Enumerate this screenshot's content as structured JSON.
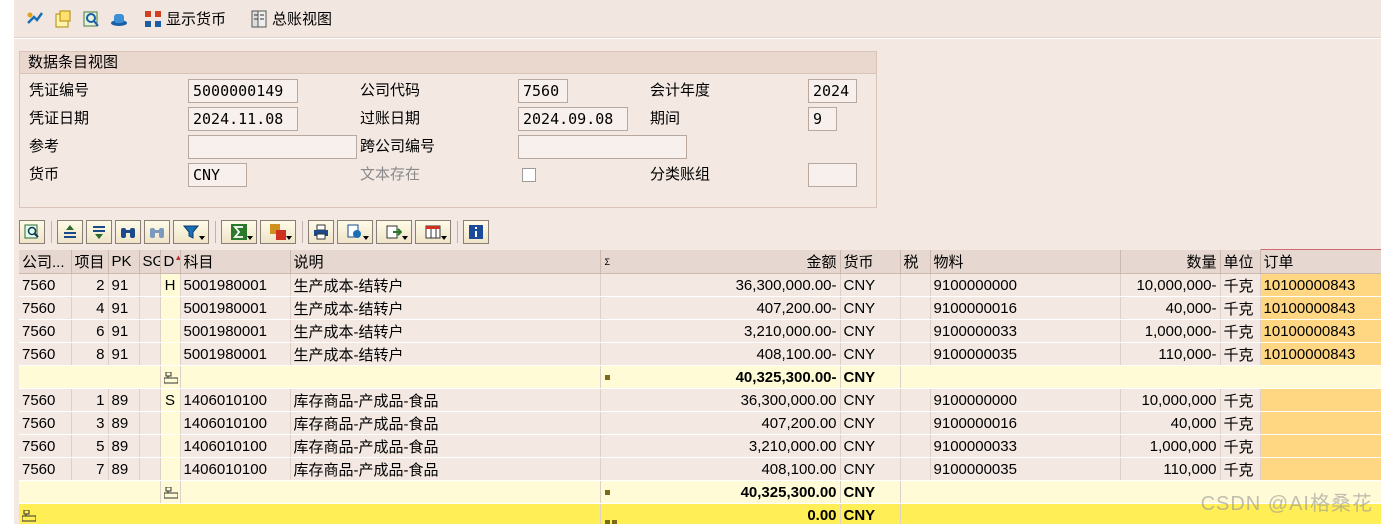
{
  "toolbar": {
    "show_currency": "显示货币",
    "gl_view": "总账视图"
  },
  "header": {
    "title": "数据条目视图",
    "doc_no_label": "凭证编号",
    "doc_no": "5000000149",
    "company_label": "公司代码",
    "company": "7560",
    "fiscal_year_label": "会计年度",
    "fiscal_year": "2024",
    "doc_date_label": "凭证日期",
    "doc_date": "2024.11.08",
    "post_date_label": "过账日期",
    "post_date": "2024.09.08",
    "period_label": "期间",
    "period": "9",
    "ref_label": "参考",
    "ref": "",
    "cross_company_label": "跨公司编号",
    "cross_company": "",
    "currency_label": "货币",
    "currency": "CNY",
    "text_exists_label": "文本存在",
    "ledger_group_label": "分类账组",
    "ledger_group": ""
  },
  "grid": {
    "columns": [
      "公司...",
      "项目",
      "PK",
      "SG",
      "D",
      "科目",
      "说明",
      "",
      "金额",
      "货币",
      "税",
      "物料",
      "数量",
      "单位",
      "订单"
    ],
    "rows": [
      {
        "co": "7560",
        "item": "2",
        "pk": "91",
        "sg": "",
        "dc": "H",
        "acct": "5001980001",
        "desc": "生产成本-结转户",
        "amount": "36,300,000.00-",
        "cur": "CNY",
        "tax": "",
        "mat": "9100000000",
        "qty": "10,000,000-",
        "unit": "千克",
        "order": "10100000843"
      },
      {
        "co": "7560",
        "item": "4",
        "pk": "91",
        "sg": "",
        "dc": "",
        "acct": "5001980001",
        "desc": "生产成本-结转户",
        "amount": "407,200.00-",
        "cur": "CNY",
        "tax": "",
        "mat": "9100000016",
        "qty": "40,000-",
        "unit": "千克",
        "order": "10100000843"
      },
      {
        "co": "7560",
        "item": "6",
        "pk": "91",
        "sg": "",
        "dc": "",
        "acct": "5001980001",
        "desc": "生产成本-结转户",
        "amount": "3,210,000.00-",
        "cur": "CNY",
        "tax": "",
        "mat": "9100000033",
        "qty": "1,000,000-",
        "unit": "千克",
        "order": "10100000843"
      },
      {
        "co": "7560",
        "item": "8",
        "pk": "91",
        "sg": "",
        "dc": "",
        "acct": "5001980001",
        "desc": "生产成本-结转户",
        "amount": "408,100.00-",
        "cur": "CNY",
        "tax": "",
        "mat": "9100000035",
        "qty": "110,000-",
        "unit": "千克",
        "order": "10100000843"
      }
    ],
    "subtotal_h": {
      "amount": "40,325,300.00-",
      "cur": "CNY"
    },
    "rows2": [
      {
        "co": "7560",
        "item": "1",
        "pk": "89",
        "sg": "",
        "dc": "S",
        "acct": "1406010100",
        "desc": "库存商品-产成品-食品",
        "amount": "36,300,000.00",
        "cur": "CNY",
        "tax": "",
        "mat": "9100000000",
        "qty": "10,000,000",
        "unit": "千克",
        "order": ""
      },
      {
        "co": "7560",
        "item": "3",
        "pk": "89",
        "sg": "",
        "dc": "",
        "acct": "1406010100",
        "desc": "库存商品-产成品-食品",
        "amount": "407,200.00",
        "cur": "CNY",
        "tax": "",
        "mat": "9100000016",
        "qty": "40,000",
        "unit": "千克",
        "order": ""
      },
      {
        "co": "7560",
        "item": "5",
        "pk": "89",
        "sg": "",
        "dc": "",
        "acct": "1406010100",
        "desc": "库存商品-产成品-食品",
        "amount": "3,210,000.00",
        "cur": "CNY",
        "tax": "",
        "mat": "9100000033",
        "qty": "1,000,000",
        "unit": "千克",
        "order": ""
      },
      {
        "co": "7560",
        "item": "7",
        "pk": "89",
        "sg": "",
        "dc": "",
        "acct": "1406010100",
        "desc": "库存商品-产成品-食品",
        "amount": "408,100.00",
        "cur": "CNY",
        "tax": "",
        "mat": "9100000035",
        "qty": "110,000",
        "unit": "千克",
        "order": ""
      }
    ],
    "subtotal_s": {
      "amount": "40,325,300.00",
      "cur": "CNY"
    },
    "total": {
      "amount": "0.00",
      "cur": "CNY"
    }
  },
  "watermark": "CSDN @AI格桑花"
}
